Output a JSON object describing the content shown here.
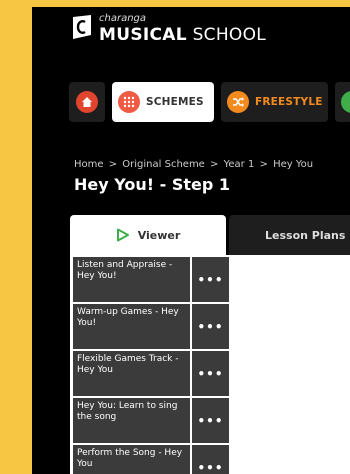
{
  "brand": {
    "small_text": "charanga",
    "name_bold": "MUSICAL",
    "name_light": "SCHOOL"
  },
  "nav": {
    "items": [
      {
        "label": "",
        "icon": "home-icon"
      },
      {
        "label": "SCHEMES",
        "icon": "grid-icon"
      },
      {
        "label": "FREESTYLE",
        "icon": "shuffle-icon"
      },
      {
        "label": "",
        "icon": "more-icon"
      }
    ]
  },
  "breadcrumb": [
    "Home",
    ">",
    "Original Scheme",
    ">",
    "Year 1",
    ">",
    "Hey You"
  ],
  "page_title": "Hey You! - Step 1",
  "tabs": [
    {
      "label": "Viewer",
      "icon": "play-icon",
      "active": true
    },
    {
      "label": "Lesson Plans",
      "active": false
    }
  ],
  "resources": [
    {
      "title": "Listen and Appraise - Hey You!",
      "more": "•••"
    },
    {
      "title": "Warm-up Games - Hey You!",
      "more": "•••"
    },
    {
      "title": "Flexible Games Track - Hey You",
      "more": "•••"
    },
    {
      "title": "Hey You: Learn to sing the song",
      "more": "•••"
    },
    {
      "title": "Perform the Song - Hey You",
      "more": "•••"
    }
  ],
  "colors": {
    "background": "#f7c744",
    "screen": "#000000",
    "home": "#e2452e",
    "schemes": "#ee5a44",
    "freestyle": "#f28a1e",
    "green": "#3fae49",
    "tile": "#3b3b3b"
  }
}
